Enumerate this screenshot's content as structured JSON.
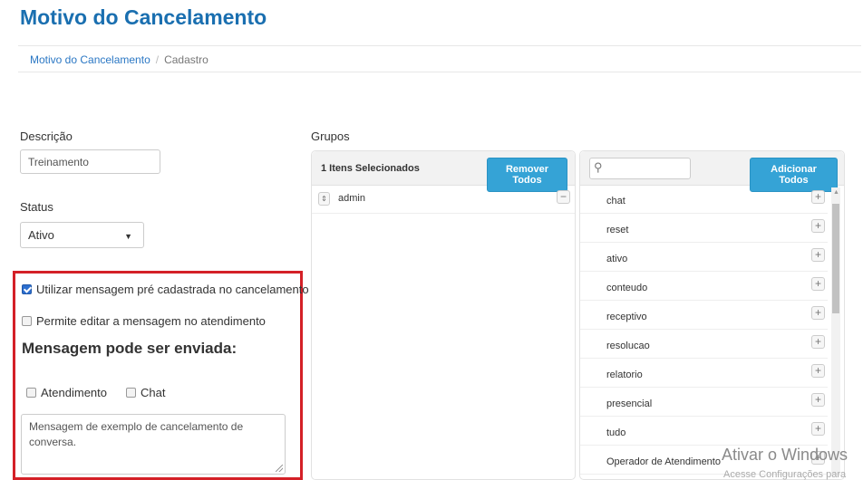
{
  "page_title": "Motivo do Cancelamento",
  "breadcrumb": {
    "link": "Motivo do Cancelamento",
    "separator": "/",
    "current": "Cadastro"
  },
  "form": {
    "descricao_label": "Descrição",
    "descricao_value": "Treinamento",
    "status_label": "Status",
    "status_value": "Ativo",
    "grupos_label": "Grupos"
  },
  "message_box": {
    "use_predefined_label": "Utilizar mensagem pré cadastrada no cancelamento",
    "use_predefined_checked": true,
    "allow_edit_label": "Permite editar a mensagem no atendimento",
    "allow_edit_checked": false,
    "send_heading": "Mensagem pode ser enviada:",
    "atendimento_label": "Atendimento",
    "atendimento_checked": false,
    "chat_label": "Chat",
    "chat_checked": false,
    "message_text": "Mensagem de exemplo de cancelamento de conversa."
  },
  "selected_panel": {
    "count_label": "1 Itens Selecionados",
    "remove_all_label": "Remover Todos",
    "items": [
      "admin"
    ],
    "remove_icon": "−"
  },
  "available_panel": {
    "search_icon": "⚲",
    "search_value": "",
    "add_all_label": "Adicionar Todos",
    "items": [
      "chat",
      "reset",
      "ativo",
      "conteudo",
      "receptivo",
      "resolucao",
      "relatorio",
      "presencial",
      "tudo",
      "Operador de Atendimento"
    ],
    "add_icon": "+"
  },
  "watermark": {
    "line1": "Ativar o Windows",
    "line2": "Acesse Configurações para"
  },
  "colors": {
    "title": "#1a6fb0",
    "accent_button": "#35a3d6",
    "highlight_border": "#d42027"
  }
}
